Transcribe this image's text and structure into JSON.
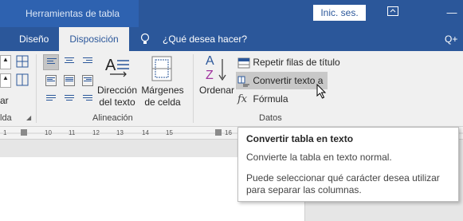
{
  "titlebar": {
    "tools_label": "Herramientas de tabla",
    "signin_label": "Inic. ses.",
    "restore_glyph": "⧉",
    "minimize_glyph": "—"
  },
  "tabs": {
    "design": "Diseño",
    "layout": "Disposición",
    "tell_me": "¿Qué desea hacer?",
    "share_glyph": "Q+"
  },
  "ribbon": {
    "left_partial_dropdown": "ar",
    "left_group_label_partial": "lda",
    "text_direction": {
      "line1": "Dirección",
      "line2": "del texto"
    },
    "cell_margins": {
      "line1": "Márgenes",
      "line2": "de celda"
    },
    "alignment_group": "Alineación",
    "sort": "Ordenar",
    "repeat_header": "Repetir filas de título",
    "convert_to_text": "Convertir texto a",
    "formula": "Fórmula",
    "formula_glyph": "fx",
    "data_group": "Datos",
    "sort_letters": {
      "a": "A",
      "z": "Z"
    }
  },
  "ruler": {
    "marks": [
      "1",
      "10",
      "11",
      "12",
      "13",
      "14",
      "15",
      "16"
    ]
  },
  "tooltip": {
    "title": "Convertir tabla en texto",
    "description": "Convierte la tabla en texto normal.",
    "detail": "Puede seleccionar qué carácter desea utilizar para separar las columnas."
  },
  "colors": {
    "brand": "#2b579a",
    "ribbon_bg": "#f0f0f0",
    "hover": "#c8c8c8"
  }
}
